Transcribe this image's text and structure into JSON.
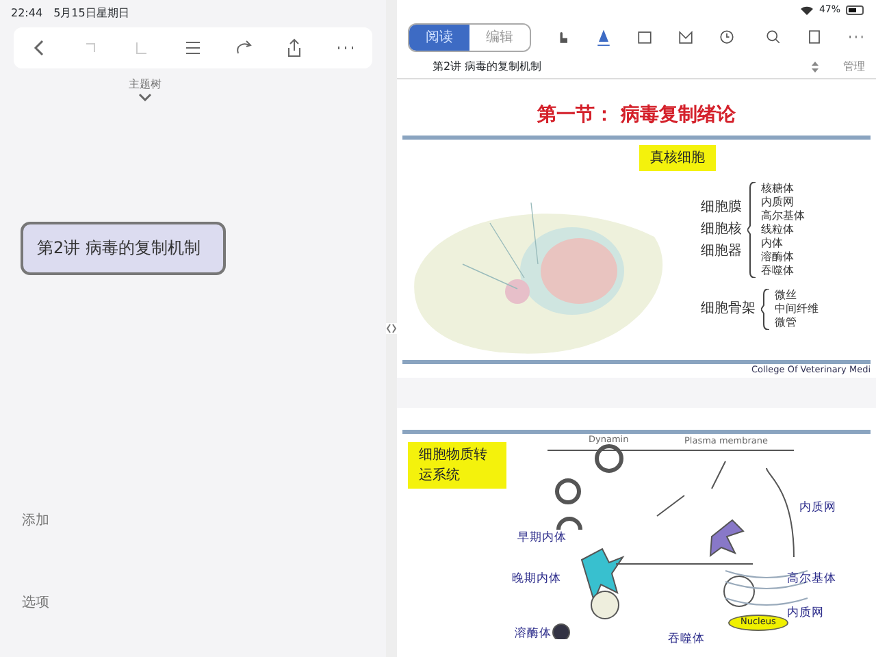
{
  "status_bar": {
    "time": "22:44",
    "date": "5月15日星期日",
    "battery": "47%"
  },
  "outline": {
    "collapse_label": "主题树",
    "topic": "第2讲  病毒的复制机制",
    "side_labels": [
      "添加",
      "选项"
    ]
  },
  "viewer": {
    "modes": [
      {
        "label": "阅读",
        "selected": true
      },
      {
        "label": "编辑",
        "selected": false
      }
    ],
    "doc_title": "第2讲  病毒的复制机制",
    "action": "管理",
    "slide_1": {
      "title": "第一节：  病毒复制绪论",
      "highlight": "真核细胞",
      "groups": [
        {
          "labels": [
            "细胞膜",
            "细胞核",
            "细胞器"
          ],
          "items": [
            "核糖体",
            "内质网",
            "高尔基体",
            "线粒体",
            "内体",
            "溶酶体",
            "吞噬体"
          ]
        },
        {
          "labels": [
            "细胞骨架"
          ],
          "items": [
            "微丝",
            "中间纤维",
            "微管"
          ]
        }
      ],
      "footer": "College Of Veterinary Medi"
    },
    "slide_2": {
      "highlight": "细胞物质转运系统",
      "diagram_labels": [
        {
          "text": "Dynamin",
          "kind": "note"
        },
        {
          "text": "Plasma membrane",
          "kind": "note"
        },
        {
          "text": "早期内体",
          "kind": "organelle"
        },
        {
          "text": "晚期内体",
          "kind": "organelle"
        },
        {
          "text": "溶酶体",
          "kind": "organelle"
        },
        {
          "text": "吞噬体",
          "kind": "organelle"
        },
        {
          "text": "内质网",
          "kind": "organelle"
        },
        {
          "text": "高尔基体",
          "kind": "organelle"
        },
        {
          "text": "内质网",
          "kind": "organelle"
        },
        {
          "text": "Nucleus",
          "kind": "nucleus"
        }
      ]
    }
  }
}
